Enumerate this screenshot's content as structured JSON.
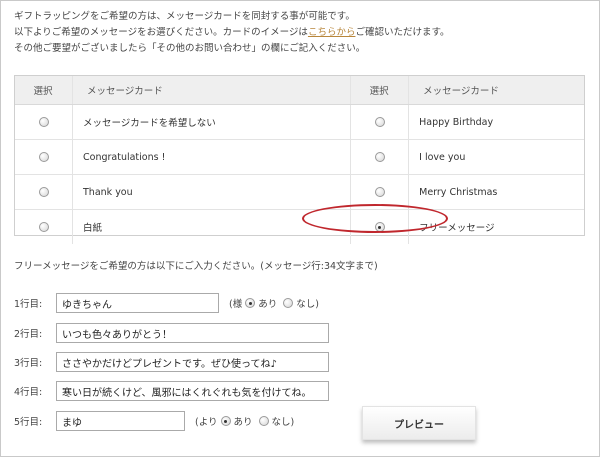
{
  "intro": {
    "line1": "ギフトラッピングをご希望の方は、メッセージカードを同封する事が可能です。",
    "line2_pre": "以下よりご希望のメッセージをお選びください。カードのイメージは",
    "line2_link": "こちらから",
    "line2_post": "ご確認いただけます。",
    "line3": "その他ご要望がございましたら「その他のお問い合わせ」の欄にご記入ください。"
  },
  "table": {
    "col_select": "選択",
    "col_message": "メッセージカード",
    "left": [
      "メッセージカードを希望しない",
      "Congratulations !",
      "Thank you",
      "白紙"
    ],
    "right": [
      "Happy Birthday",
      "I love you",
      "Merry Christmas",
      "フリーメッセージ"
    ],
    "selected": "フリーメッセージ"
  },
  "instruction": "フリーメッセージをご希望の方は以下にご入力ください。(メッセージ行:34文字まで)",
  "lines": [
    {
      "label": "1行目:",
      "value": "ゆきちゃん"
    },
    {
      "label": "2行目:",
      "value": "いつも色々ありがとう！"
    },
    {
      "label": "3行目:",
      "value": "ささやかだけどプレゼントです。ぜひ使ってね♪"
    },
    {
      "label": "4行目:",
      "value": "寒い日が続くけど、風邪にはくれぐれも気を付けてね。"
    },
    {
      "label": "5行目:",
      "value": "まゆ"
    }
  ],
  "honorific": {
    "open": "(様",
    "yes": "あり",
    "no": "なし)",
    "selected": "あり"
  },
  "sender": {
    "open": "(より",
    "yes": "あり",
    "no": "なし)",
    "selected": "あり"
  },
  "preview_label": "プレビュー"
}
